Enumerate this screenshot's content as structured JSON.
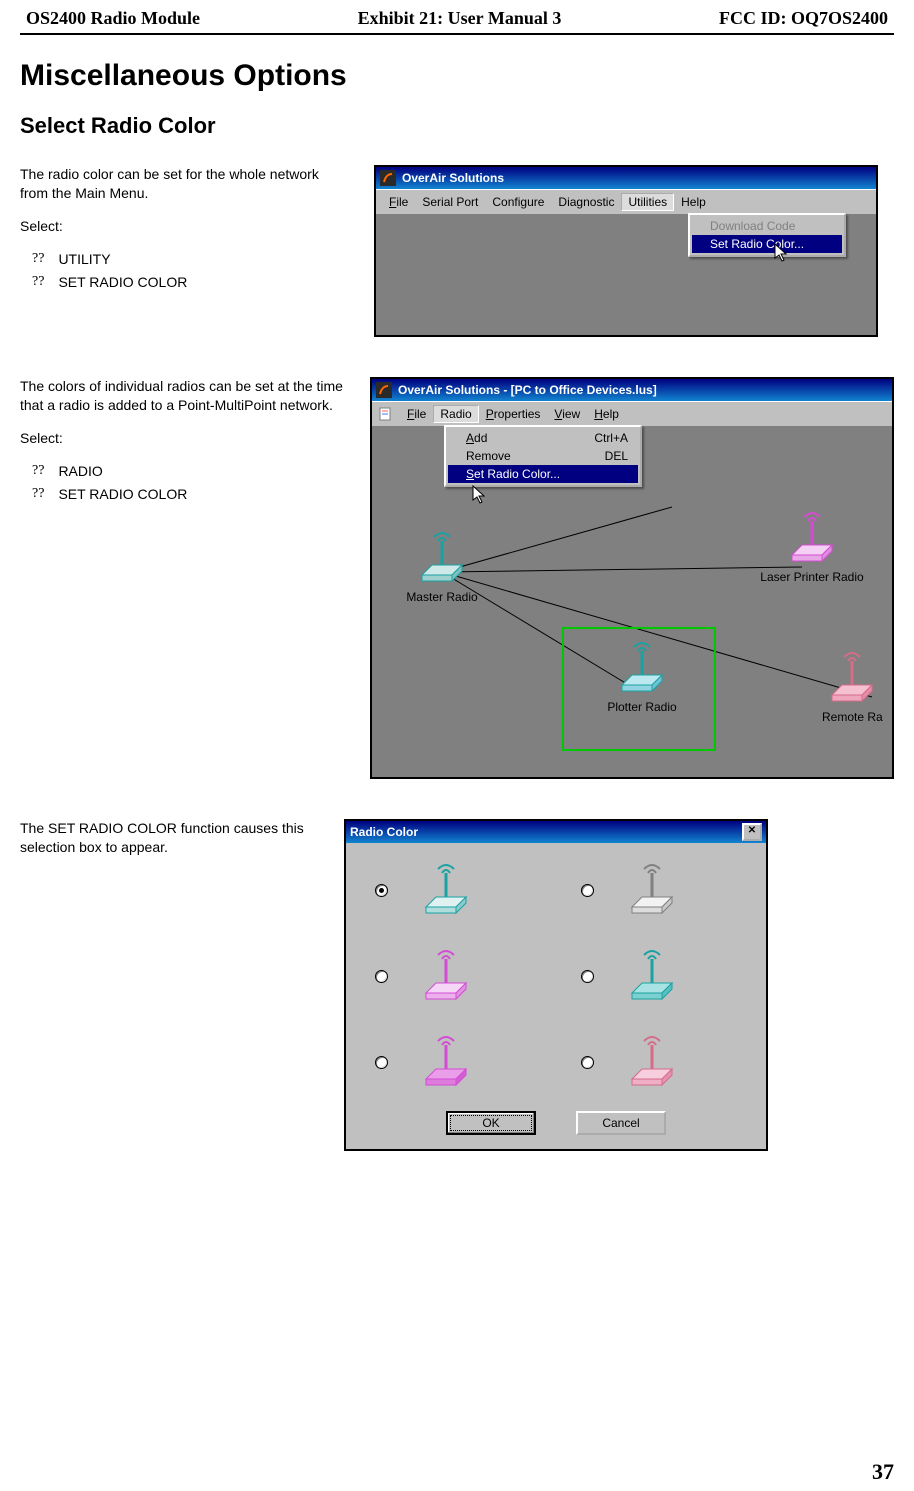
{
  "header": {
    "left": "OS2400 Radio Module",
    "center": "Exhibit 21: User Manual 3",
    "right": "FCC ID: OQ7OS2400"
  },
  "h1": "Miscellaneous Options",
  "h2": "Select Radio Color",
  "section1": {
    "para": "The radio color can be set for the whole network from the Main Menu.",
    "select_label": "Select:",
    "b1": "UTILITY",
    "b2": "SET RADIO COLOR",
    "qq": "??",
    "win_title": "OverAir Solutions",
    "menus": {
      "file": "File",
      "serial": "Serial Port",
      "configure": "Configure",
      "diagnostic": "Diagnostic",
      "utilities": "Utilities",
      "help": "Help"
    },
    "popup": {
      "download": "Download Code",
      "set_color": "Set Radio Color..."
    }
  },
  "section2": {
    "para": "The colors of individual radios can be set at the time that a radio is added to a Point-MultiPoint network.",
    "select_label": "Select:",
    "b1": "RADIO",
    "b2": "SET RADIO COLOR",
    "qq": "??",
    "win_title": "OverAir Solutions - [PC to Office Devices.lus]",
    "menus": {
      "file": "File",
      "radio": "Radio",
      "properties": "Properties",
      "view": "View",
      "help": "Help"
    },
    "popup": {
      "add": "Add",
      "add_sc": "Ctrl+A",
      "remove": "Remove",
      "remove_sc": "DEL",
      "set_color": "Set Radio Color..."
    },
    "nodes": {
      "master": "Master Radio",
      "laser": "Laser Printer Radio",
      "plotter": "Plotter Radio",
      "remote": "Remote Ra"
    }
  },
  "section3": {
    "para": "The SET RADIO COLOR function causes this selection box to appear.",
    "dlg_title": "Radio Color",
    "ok": "OK",
    "cancel": "Cancel",
    "colors": {
      "c1": "#1aa2a2",
      "c2": "#e6e6e6",
      "c3": "#d44cd4",
      "c4": "#2aa5a5",
      "c5": "#d44cd4",
      "c6": "#f5a9c0"
    }
  },
  "page_number": "37"
}
